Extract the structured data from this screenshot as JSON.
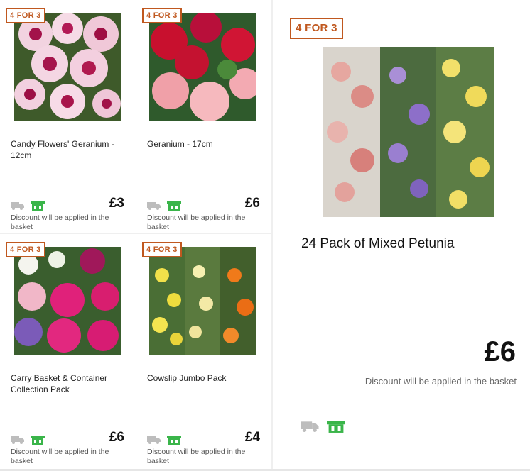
{
  "badge": "4 FOR 3",
  "products": [
    {
      "name": "Candy Flowers' Geranium - 12cm",
      "price": "£3",
      "discount": "Discount will be applied in the basket"
    },
    {
      "name": "Geranium - 17cm",
      "price": "£6",
      "discount": "Discount will be applied in the basket"
    },
    {
      "name": "Carry Basket & Container Collection Pack",
      "price": "£6",
      "discount": "Discount will be applied in the basket"
    },
    {
      "name": "Cowslip Jumbo Pack",
      "price": "£4",
      "discount": "Discount will be applied in the basket"
    }
  ],
  "featured": {
    "name": "24 Pack of Mixed Petunia",
    "price": "£6",
    "discount": "Discount will be applied in the basket"
  },
  "icons": {
    "delivery": "delivery-truck-icon",
    "collect": "click-and-collect-icon"
  },
  "colors": {
    "badge": "#c0581f",
    "collect": "#3ab54a",
    "truck": "#bdbdbd"
  }
}
